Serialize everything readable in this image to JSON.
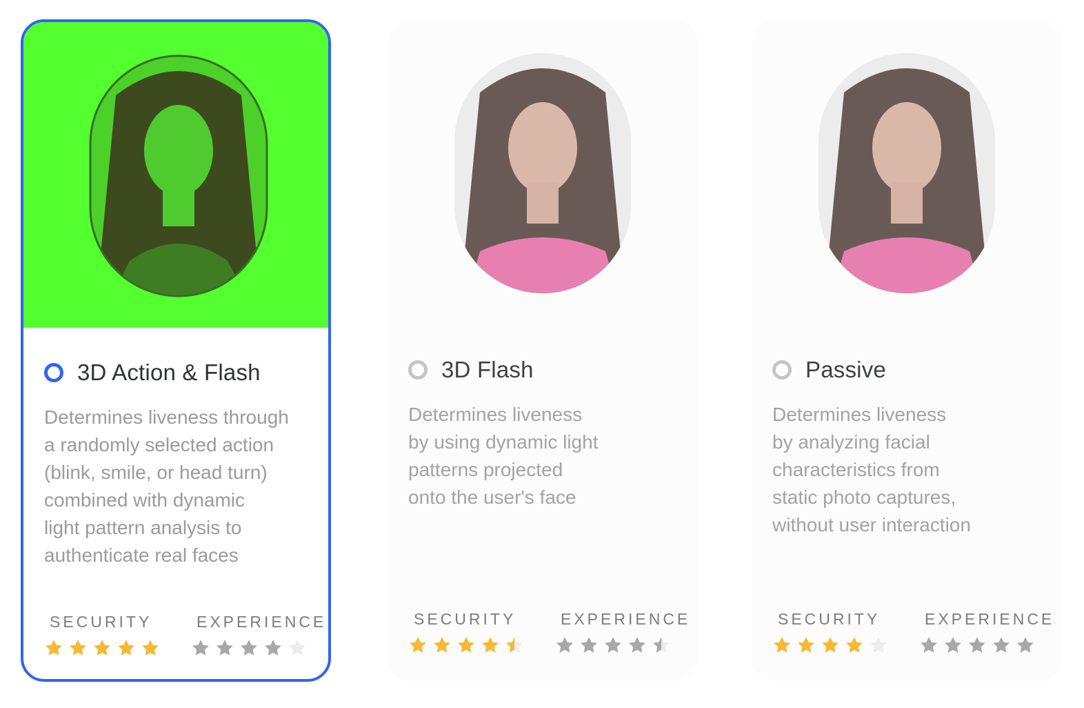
{
  "colors": {
    "selected_border": "#2f66f0",
    "selected_hero": "#53ff2e",
    "security_star": "#f7b933",
    "experience_star": "#a8a8a8",
    "empty_star": "#ececec"
  },
  "options": [
    {
      "title": "3D Action & Flash",
      "selected": true,
      "description": "Determines liveness through\na randomly selected action\n(blink, smile, or head turn)\ncombined with dynamic\nlight pattern analysis to\nauthenticate real faces",
      "security_label": "SECURITY",
      "experience_label": "EXPERIENCE",
      "security_rating": 5,
      "experience_rating": 4
    },
    {
      "title": "3D Flash",
      "selected": false,
      "description": "Determines liveness\nby using dynamic light\npatterns projected\nonto the user's face",
      "security_label": "SECURITY",
      "experience_label": "EXPERIENCE",
      "security_rating": 4.5,
      "experience_rating": 4.5
    },
    {
      "title": "Passive",
      "selected": false,
      "description": "Determines liveness\nby analyzing facial\ncharacteristics from\nstatic photo captures,\nwithout user interaction",
      "security_label": "SECURITY",
      "experience_label": "EXPERIENCE",
      "security_rating": 4,
      "experience_rating": 5
    }
  ]
}
